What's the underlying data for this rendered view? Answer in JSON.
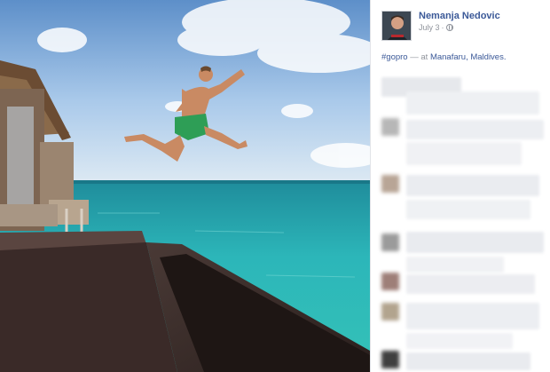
{
  "post": {
    "author_name": "Nemanja Nedovic",
    "date": "July 3",
    "privacy_icon": "globe-icon",
    "hashtag": "#gopro",
    "location_prefix": "— at",
    "location": "Manafaru, Maldives."
  },
  "colors": {
    "link": "#3b5998",
    "meta": "#90949c",
    "sea": "#2bb3b8",
    "sky": "#8fb8e6"
  }
}
